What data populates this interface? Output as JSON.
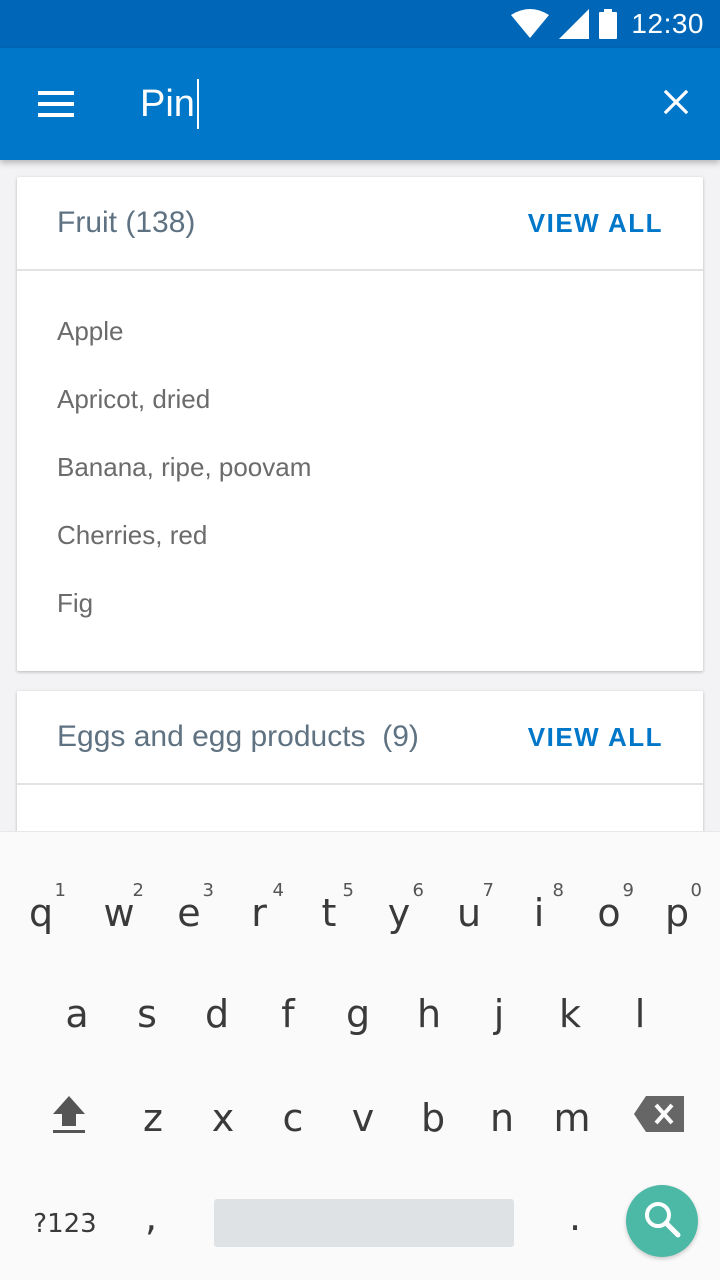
{
  "status_bar": {
    "time": "12:30",
    "icons": [
      "wifi-icon",
      "signal-icon",
      "battery-icon"
    ],
    "background": "#0067b8"
  },
  "app_bar": {
    "background": "#0077c8",
    "menu_icon": "menu-icon",
    "search_value": "Pin",
    "close_icon": "close-icon"
  },
  "results": [
    {
      "title": "Fruit (138)",
      "action": "VIEW ALL",
      "items": [
        "Apple",
        "Apricot, dried",
        "Banana, ripe, poovam",
        "Cherries, red",
        "Fig"
      ]
    },
    {
      "title": "Eggs and egg products  (9)",
      "action": "VIEW ALL",
      "items": []
    }
  ],
  "keyboard": {
    "row1": [
      {
        "key": "q",
        "hint": "1"
      },
      {
        "key": "w",
        "hint": "2"
      },
      {
        "key": "e",
        "hint": "3"
      },
      {
        "key": "r",
        "hint": "4"
      },
      {
        "key": "t",
        "hint": "5"
      },
      {
        "key": "y",
        "hint": "6"
      },
      {
        "key": "u",
        "hint": "7"
      },
      {
        "key": "i",
        "hint": "8"
      },
      {
        "key": "o",
        "hint": "9"
      },
      {
        "key": "p",
        "hint": "0"
      }
    ],
    "row2": [
      "a",
      "s",
      "d",
      "f",
      "g",
      "h",
      "j",
      "k",
      "l"
    ],
    "row3": [
      "z",
      "x",
      "c",
      "v",
      "b",
      "n",
      "m"
    ],
    "symbols_label": "?123",
    "comma": ",",
    "period": ".",
    "shift_icon": "shift-icon",
    "backspace_icon": "backspace-icon",
    "search_icon": "search-icon",
    "accent": "#4cb8a6"
  }
}
